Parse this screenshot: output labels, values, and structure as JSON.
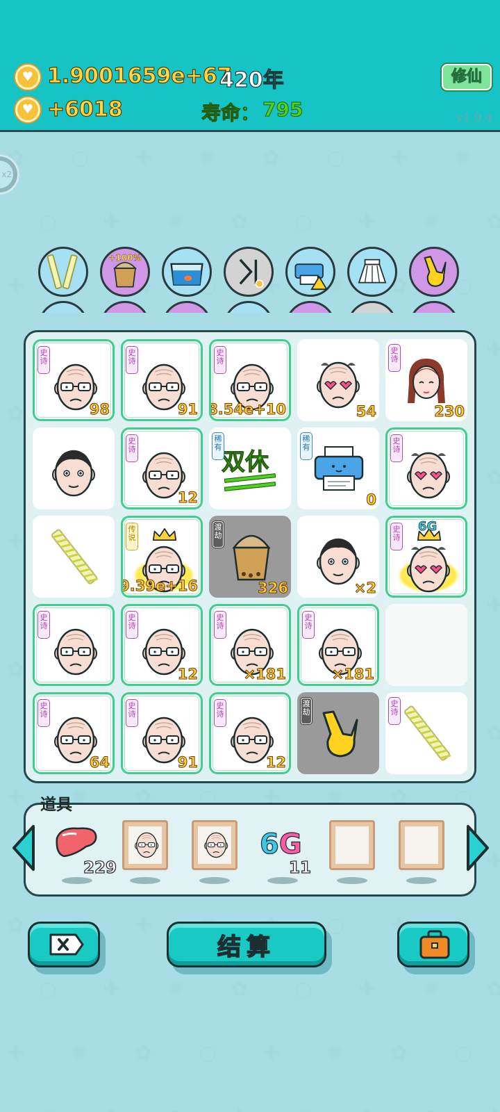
{
  "header": {
    "gold": "1.9001659e+67",
    "year": "420年",
    "income": "+6018",
    "lifespan_label": "寿命：",
    "lifespan_value": "795",
    "cultivate_button": "修仙",
    "version": "v1.9.4"
  },
  "side_ball_label": "x2",
  "skills": [
    {
      "icon": "straw-icon",
      "bg": "#a6e0f3"
    },
    {
      "icon": "bubble-tea-boost-icon",
      "bg": "#cf97e6",
      "badge": "+100%"
    },
    {
      "icon": "fish-tank-icon",
      "bg": "#a6e0f3"
    },
    {
      "icon": "skip-icon",
      "bg": "#d3d3d3"
    },
    {
      "icon": "printer-warning-icon",
      "bg": "#a6e0f3"
    },
    {
      "icon": "skirt-icon",
      "bg": "#a6e0f3"
    },
    {
      "icon": "rock-hand-icon",
      "bg": "#cf97e6"
    }
  ],
  "board": [
    [
      {
        "type": "old-man",
        "tag": "史诗",
        "rarity": "epic",
        "count": "98"
      },
      {
        "type": "old-man",
        "tag": "史诗",
        "rarity": "epic",
        "count": "91"
      },
      {
        "type": "old-man",
        "tag": "史诗",
        "rarity": "epic",
        "count": "8.54e+10"
      },
      {
        "type": "heart-glasses-man",
        "tag": "",
        "rarity": "common",
        "count": "54"
      },
      {
        "type": "braid-girl",
        "tag": "史诗",
        "rarity": "common",
        "count": "230"
      }
    ],
    [
      {
        "type": "young-man",
        "tag": "",
        "rarity": "common",
        "count": ""
      },
      {
        "type": "old-man",
        "tag": "史诗",
        "rarity": "epic",
        "count": "12"
      },
      {
        "type": "shuangxiu-text",
        "tag": "稀有",
        "rarity": "rare",
        "count": "",
        "text": "双休"
      },
      {
        "type": "printer",
        "tag": "稀有",
        "rarity": "rare",
        "count": "0"
      },
      {
        "type": "old-man-heart-glasses",
        "tag": "史诗",
        "rarity": "epic",
        "count": ""
      }
    ],
    [
      {
        "type": "straw",
        "tag": "",
        "rarity": "common",
        "count": ""
      },
      {
        "type": "crown-king",
        "tag": "传说",
        "rarity": "legend",
        "count": "9.39e+16"
      },
      {
        "type": "bubble-tea",
        "tag": "渡劫",
        "rarity": "gray",
        "count": "326"
      },
      {
        "type": "young-man",
        "tag": "",
        "rarity": "common",
        "count": "×2"
      },
      {
        "type": "crown-6g",
        "tag": "史诗",
        "rarity": "epic",
        "count": "",
        "badge": "6G"
      }
    ],
    [
      {
        "type": "old-man",
        "tag": "史诗",
        "rarity": "epic",
        "count": ""
      },
      {
        "type": "old-man",
        "tag": "史诗",
        "rarity": "epic",
        "count": "12"
      },
      {
        "type": "old-man",
        "tag": "史诗",
        "rarity": "epic",
        "count": "×181"
      },
      {
        "type": "old-man",
        "tag": "史诗",
        "rarity": "epic",
        "count": "×181"
      },
      {
        "type": "empty",
        "tag": "",
        "rarity": "empty",
        "count": ""
      }
    ],
    [
      {
        "type": "old-man",
        "tag": "史诗",
        "rarity": "epic",
        "count": "64"
      },
      {
        "type": "old-man",
        "tag": "史诗",
        "rarity": "epic",
        "count": "91"
      },
      {
        "type": "old-man",
        "tag": "史诗",
        "rarity": "epic",
        "count": "12"
      },
      {
        "type": "rock-hand",
        "tag": "渡劫",
        "rarity": "gray",
        "count": ""
      },
      {
        "type": "straw",
        "tag": "史诗",
        "rarity": "common",
        "count": ""
      }
    ]
  ],
  "props": {
    "title": "道具",
    "items": [
      {
        "icon": "liver-icon",
        "count": "229"
      },
      {
        "icon": "portrait-frame-icon",
        "count": ""
      },
      {
        "icon": "portrait-frame-icon",
        "count": ""
      },
      {
        "icon": "6g-icon",
        "label": "6G",
        "count": "11"
      },
      {
        "icon": "empty-frame-icon",
        "count": ""
      },
      {
        "icon": "empty-frame-icon",
        "count": ""
      }
    ]
  },
  "buttons": {
    "settle_label": "结算"
  }
}
